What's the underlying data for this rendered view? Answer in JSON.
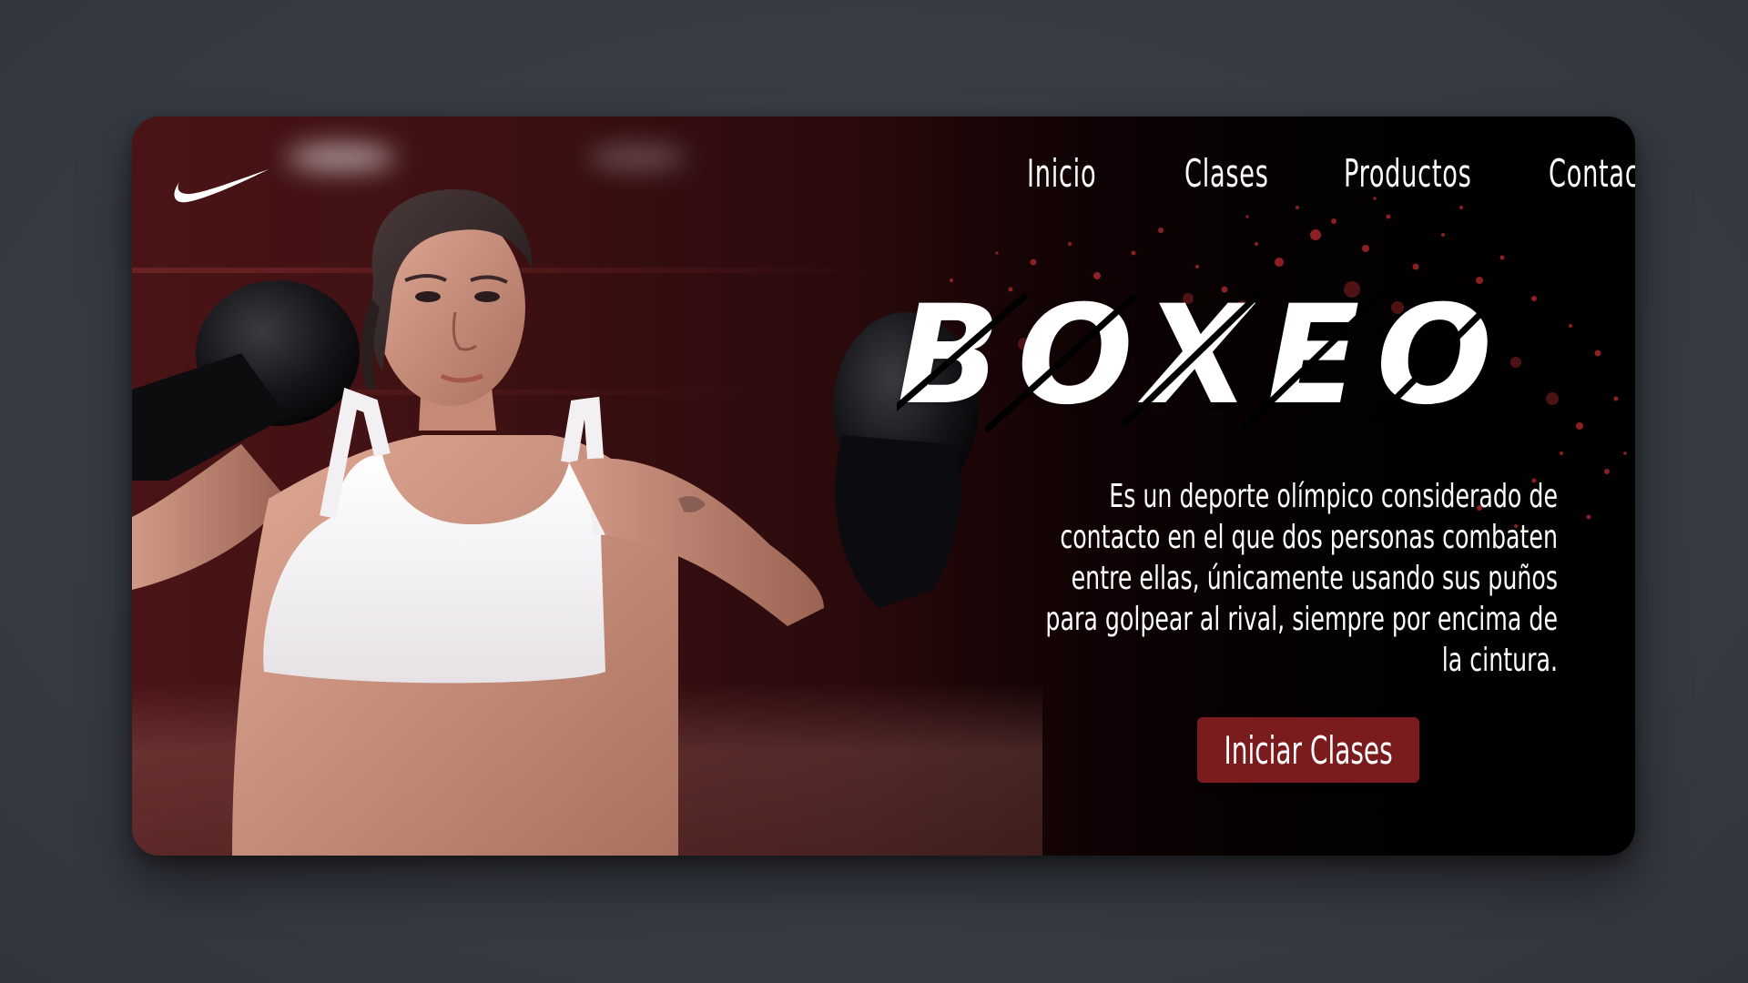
{
  "brand": {
    "logo_icon": "swoosh-logo-icon"
  },
  "nav": {
    "items": [
      {
        "label": "Inicio"
      },
      {
        "label": "Clases"
      },
      {
        "label": "Productos"
      },
      {
        "label": "Contacto"
      }
    ]
  },
  "hero": {
    "title": "BOXEO",
    "description": "Es un deporte olímpico considerado de contacto en el que dos personas combaten entre ellas, únicamente usando sus puños para golpear al rival, siempre por encima de la cintura.",
    "cta_label": "Iniciar Clases"
  },
  "colors": {
    "accent": "#7a1c1e",
    "background_outer": "#393d45",
    "card_left": "#4a1416",
    "card_right": "#000000",
    "text": "#ffffff"
  }
}
